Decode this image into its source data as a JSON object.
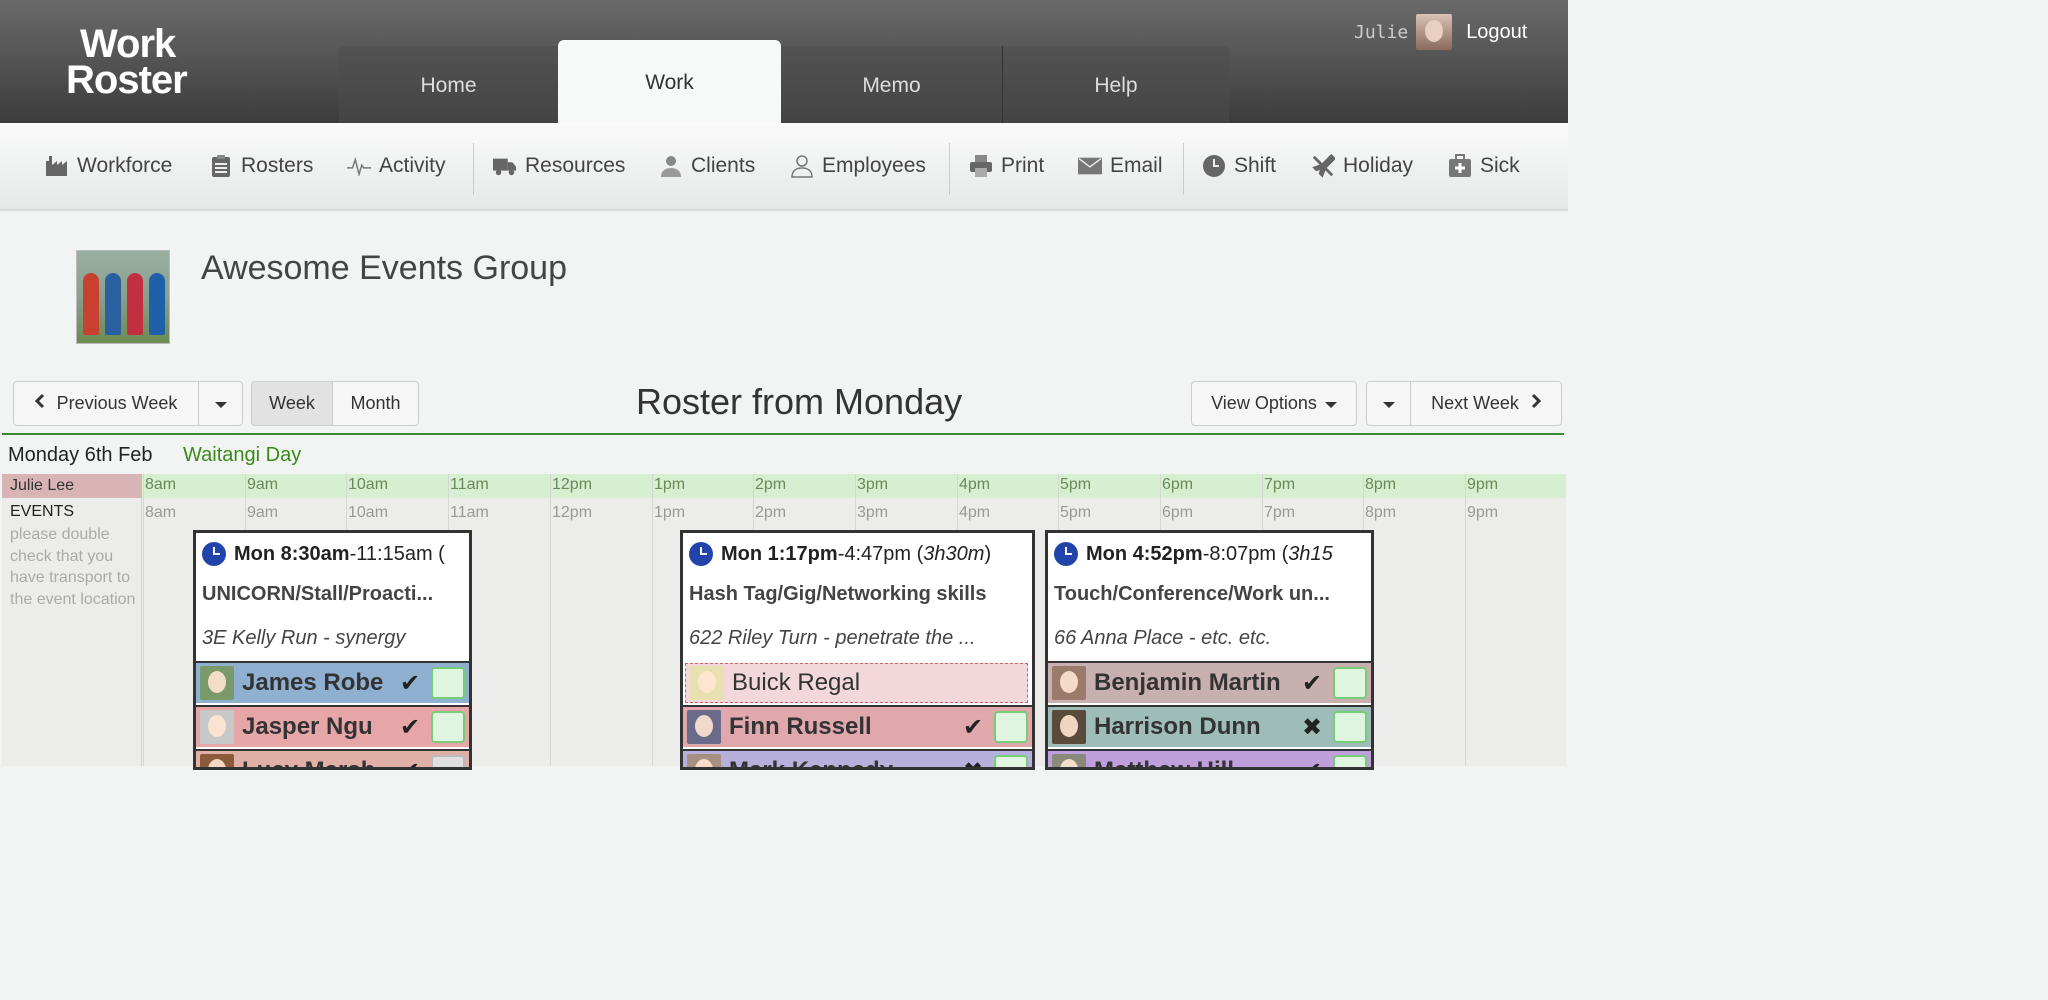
{
  "app": {
    "logo_line1": "Work",
    "logo_line2": "Roster",
    "user": "Julie",
    "logout": "Logout"
  },
  "tabs": [
    {
      "label": "Home"
    },
    {
      "label": "Work",
      "active": true
    },
    {
      "label": "Memo"
    },
    {
      "label": "Help"
    }
  ],
  "toolbar": [
    {
      "label": "Workforce",
      "icon": "factory-icon"
    },
    {
      "label": "Rosters",
      "icon": "clipboard-icon"
    },
    {
      "label": "Activity",
      "icon": "activity-icon"
    },
    {
      "label": "Resources",
      "icon": "truck-icon"
    },
    {
      "label": "Clients",
      "icon": "client-icon"
    },
    {
      "label": "Employees",
      "icon": "user-icon"
    },
    {
      "label": "Print",
      "icon": "printer-icon"
    },
    {
      "label": "Email",
      "icon": "envelope-icon"
    },
    {
      "label": "Shift",
      "icon": "clock-icon"
    },
    {
      "label": "Holiday",
      "icon": "plane-icon"
    },
    {
      "label": "Sick",
      "icon": "medkit-icon"
    }
  ],
  "org": {
    "name": "Awesome Events Group"
  },
  "controls": {
    "prev": "Previous Week",
    "week": "Week",
    "month": "Month",
    "title": "Roster from Monday",
    "view_options": "View Options",
    "next": "Next Week"
  },
  "day": {
    "label": "Monday 6th Feb",
    "holiday": "Waitangi Day",
    "owner": "Julie Lee",
    "events_label": "EVENTS",
    "events_note": "please double check that you have transport to the event location",
    "hours": [
      "8am",
      "9am",
      "10am",
      "11am",
      "12pm",
      "1pm",
      "2pm",
      "3pm",
      "4pm",
      "5pm",
      "6pm",
      "7pm",
      "8pm",
      "9pm"
    ]
  },
  "events": [
    {
      "start": "Mon 8:30am",
      "end": "-11:15am (",
      "title": "UNICORN/Stall/Proacti...",
      "location": "3E Kelly Run - synergy",
      "rows": [
        {
          "name": "James Robe",
          "status": "✔"
        },
        {
          "name": "Jasper Ngu",
          "status": "✔"
        },
        {
          "name": "Lucy Marsh",
          "status": "✔"
        }
      ]
    },
    {
      "start": "Mon 1:17pm",
      "end": "-4:47pm (",
      "duration": "3h30m",
      "end_close": ")",
      "title": "Hash Tag/Gig/Networking skills",
      "location": "622 Riley Turn - penetrate the ...",
      "vehicle": "Buick Regal",
      "rows": [
        {
          "name": "Finn Russell",
          "status": "✔"
        },
        {
          "name": "Mark Kennedy",
          "status": "✖"
        }
      ]
    },
    {
      "start": "Mon 4:52pm",
      "end": "-8:07pm (",
      "duration": "3h15",
      "title": "Touch/Conference/Work un...",
      "location": "66 Anna Place - etc. etc.",
      "rows": [
        {
          "name": "Benjamin Martin",
          "status": "✔"
        },
        {
          "name": "Harrison Dunn",
          "status": "✖"
        },
        {
          "name": "Matthew Hill",
          "status": "✔"
        }
      ]
    }
  ]
}
